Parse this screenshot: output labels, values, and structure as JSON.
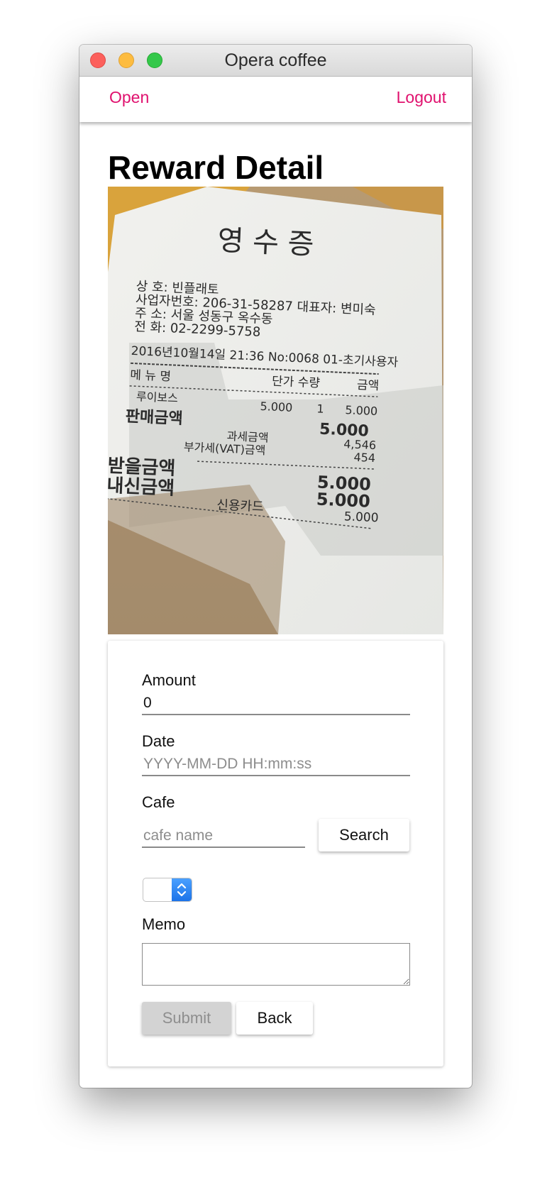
{
  "window": {
    "title": "Opera coffee"
  },
  "nav": {
    "open_label": "Open",
    "logout_label": "Logout"
  },
  "page": {
    "heading": "Reward Detail"
  },
  "receipt": {
    "title": "영 수 증",
    "lines": [
      "상  호: 빈플래토",
      "사업자번호: 206-31-58287  대표자: 변미숙",
      "주  소: 서울 성동구 옥수동",
      "전  화: 02-2299-5758",
      "2016년10월14일 21:36 No:0068 01-초기사용자",
      "메 뉴 명",
      "단가 수량",
      "금액",
      "루이보스",
      "5.000",
      "1",
      "5.000",
      "판매금액",
      "5.000",
      "과세금액",
      "4,546",
      "부가세(VAT)금액",
      "454",
      "받을금액",
      "내신금액",
      "5.000",
      "5.000",
      "신용카드",
      "5.000"
    ]
  },
  "form": {
    "amount": {
      "label": "Amount",
      "value": "0"
    },
    "date": {
      "label": "Date",
      "placeholder": "YYYY-MM-DD HH:mm:ss"
    },
    "cafe": {
      "label": "Cafe",
      "placeholder": "cafe name",
      "search_label": "Search"
    },
    "memo": {
      "label": "Memo",
      "value": ""
    },
    "submit_label": "Submit",
    "back_label": "Back"
  }
}
